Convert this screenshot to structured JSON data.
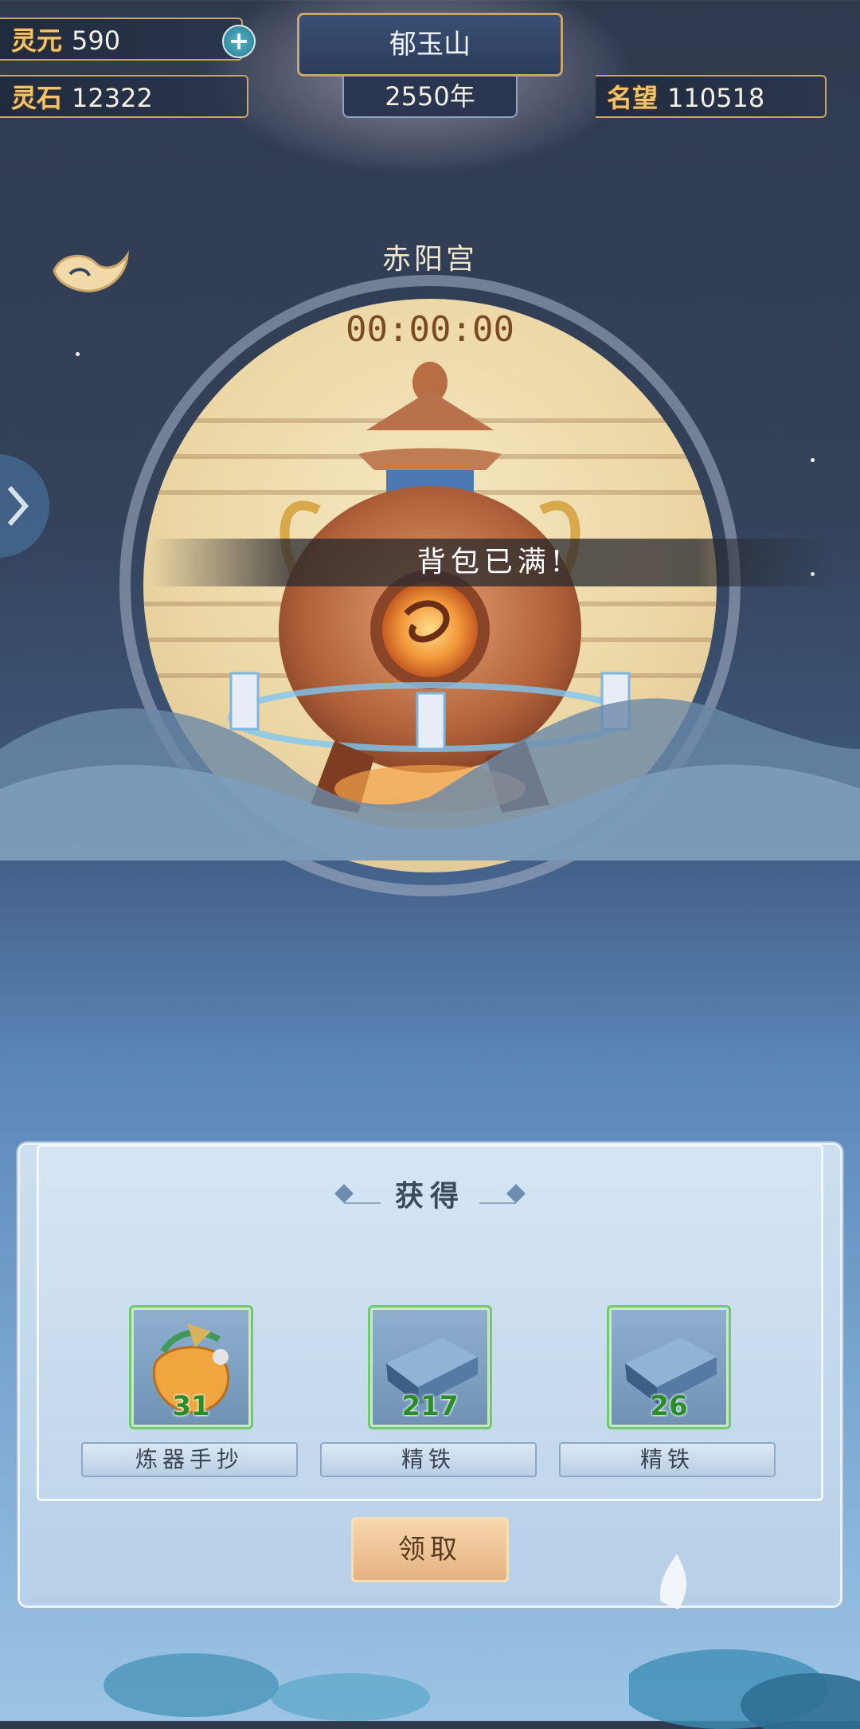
{
  "hud": {
    "lingyuan_label": "灵元",
    "lingyuan_value": "590",
    "lingshi_label": "灵石",
    "lingshi_value": "12322",
    "mingwang_label": "名望",
    "mingwang_value": "110518",
    "location": "郁玉山",
    "year": "2550年"
  },
  "scene": {
    "place": "赤阳宫",
    "timer": "00:00:00",
    "toast": "背包已满!"
  },
  "reward": {
    "title": "获得",
    "items": [
      {
        "name": "炼器手抄",
        "count": "31",
        "icon": "manual-pouch-icon"
      },
      {
        "name": "精铁",
        "count": "217",
        "icon": "iron-ingot-icon"
      },
      {
        "name": "精铁",
        "count": "26",
        "icon": "iron-ingot-icon"
      }
    ],
    "claim_label": "领取"
  },
  "colors": {
    "gold": "#c9a56a",
    "count_green": "#2b8c2a",
    "slot_border": "#74c872"
  }
}
